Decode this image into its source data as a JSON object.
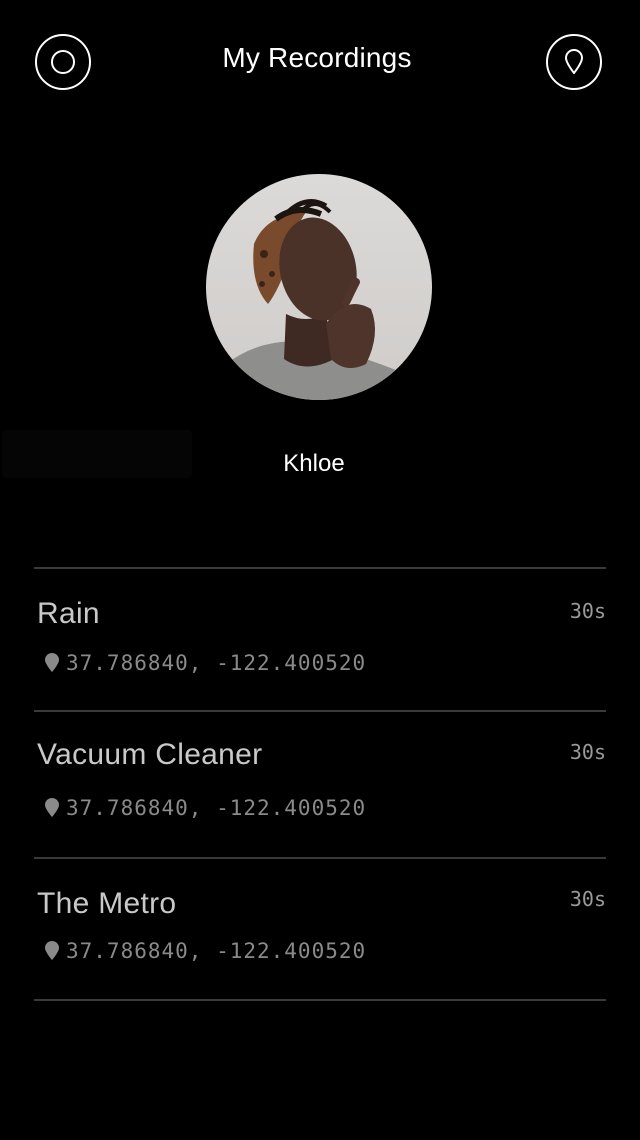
{
  "header": {
    "title": "My Recordings",
    "left_icon": "record-icon",
    "right_icon": "location-pin-icon"
  },
  "profile": {
    "name": "Khloe",
    "avatar_icon": "profile-photo"
  },
  "recordings": [
    {
      "name": "Rain",
      "duration": "30s",
      "coordinates": "37.786840, -122.400520",
      "icon": "location-pin-icon"
    },
    {
      "name": "Vacuum Cleaner",
      "duration": "30s",
      "coordinates": "37.786840, -122.400520",
      "icon": "location-pin-icon"
    },
    {
      "name": "The Metro",
      "duration": "30s",
      "coordinates": "37.786840, -122.400520",
      "icon": "location-pin-icon"
    }
  ],
  "colors": {
    "background": "#000000",
    "title": "#ffffff",
    "item_name": "#c9c9c9",
    "item_meta": "#8a8a8a",
    "divider": "#3a3a3a"
  }
}
